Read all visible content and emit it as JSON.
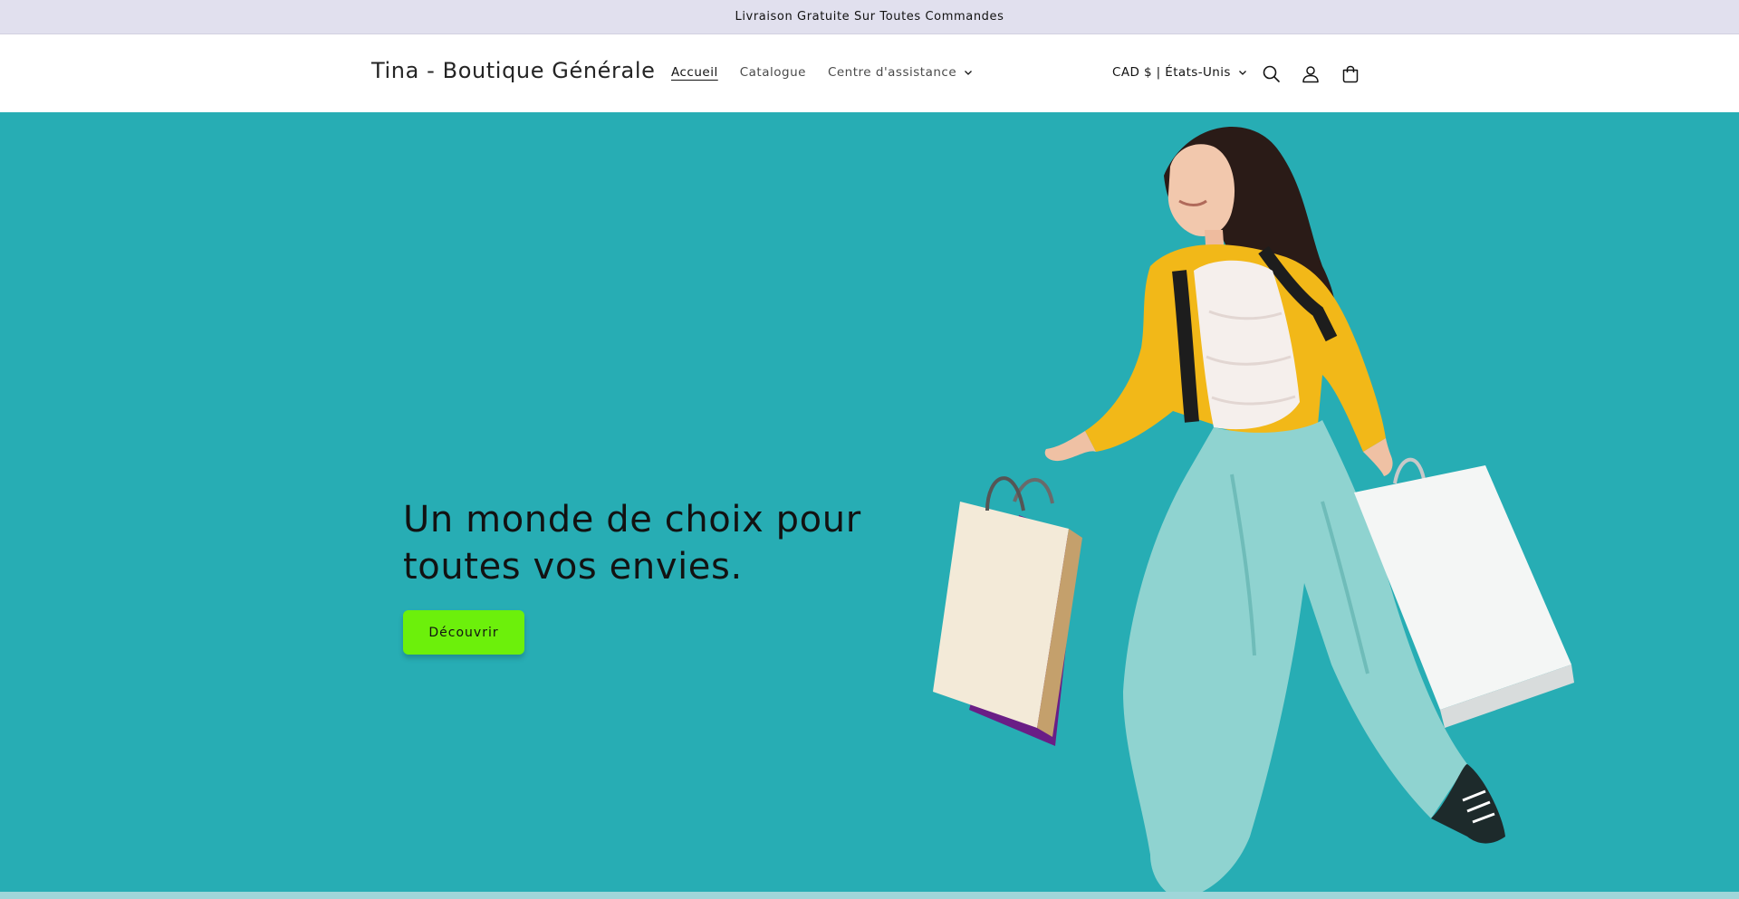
{
  "announcement": {
    "text": "Livraison Gratuite Sur Toutes Commandes"
  },
  "header": {
    "logo": "Tina - Boutique Générale",
    "nav": [
      {
        "label": "Accueil",
        "active": true
      },
      {
        "label": "Catalogue",
        "active": false
      },
      {
        "label": "Centre d'assistance",
        "active": false,
        "has_dropdown": true
      }
    ],
    "localization": "CAD $ | États-Unis",
    "icons": [
      "search-icon",
      "account-icon",
      "cart-icon"
    ]
  },
  "hero": {
    "heading": "Un monde de choix pour toutes vos envies.",
    "button_label": "Découvrir",
    "image": "woman-with-shopping-bags"
  },
  "colors": {
    "announcement_bg": "#e1e0ee",
    "hero_bg": "#27adb4",
    "button_bg": "#6cf00b",
    "text": "#121212"
  }
}
